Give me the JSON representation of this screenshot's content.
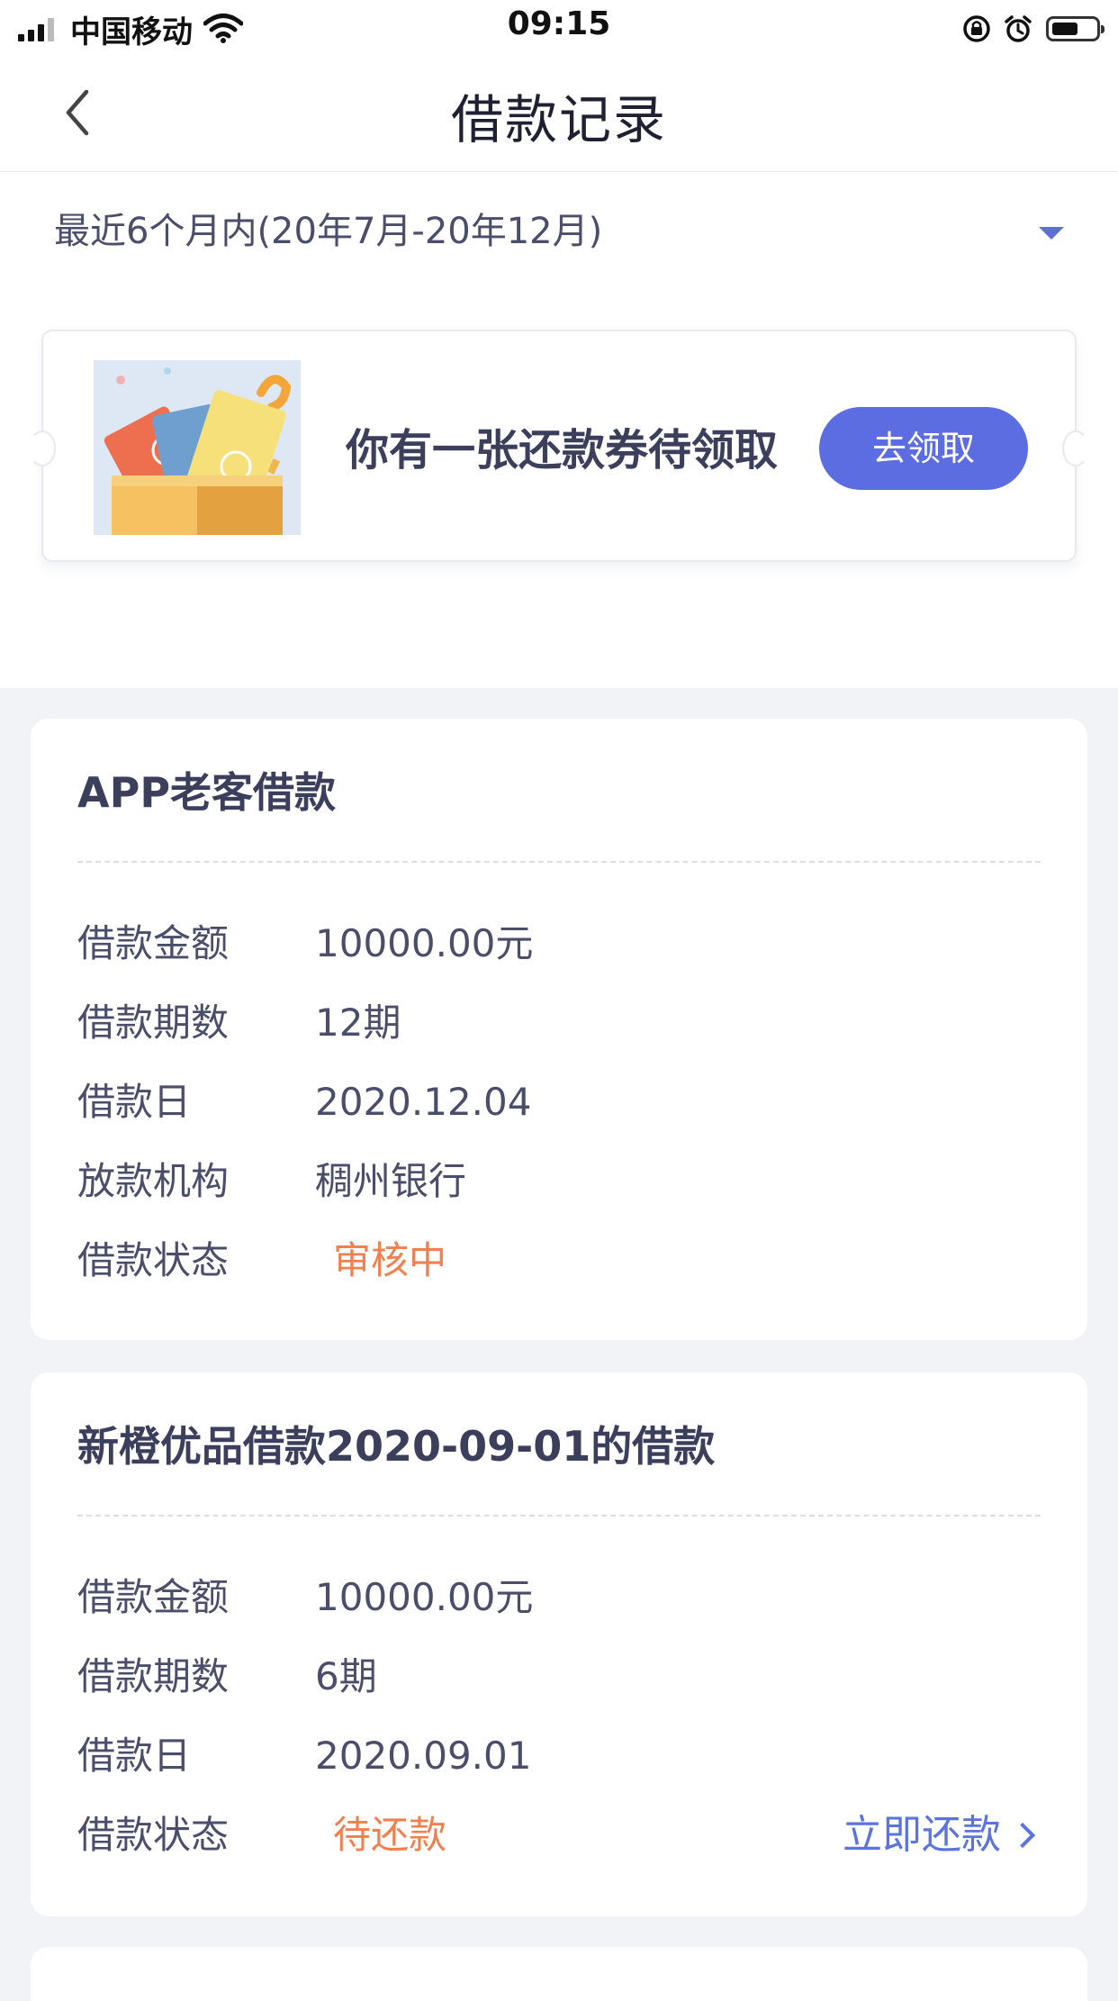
{
  "status_bar": {
    "carrier": "中国移动",
    "time": "09:15",
    "battery_level": 0.6
  },
  "nav": {
    "title": "借款记录"
  },
  "filter": {
    "label": "最近6个月内(20年7月-20年12月)"
  },
  "coupon": {
    "text": "你有一张还款券待领取",
    "button": "去领取"
  },
  "loans": [
    {
      "title": "APP老客借款",
      "rows": [
        {
          "label": "借款金额",
          "value": "10000.00元"
        },
        {
          "label": "借款期数",
          "value": "12期"
        },
        {
          "label": "借款日",
          "value": "2020.12.04"
        },
        {
          "label": "放款机构",
          "value": "稠州银行"
        },
        {
          "label": "借款状态",
          "value": "审核中"
        }
      ]
    },
    {
      "title": "新橙优品借款2020-09-01的借款",
      "rows": [
        {
          "label": "借款金额",
          "value": "10000.00元"
        },
        {
          "label": "借款期数",
          "value": "6期"
        },
        {
          "label": "借款日",
          "value": "2020.09.01"
        },
        {
          "label": "借款状态",
          "value": "待还款"
        }
      ],
      "action": "立即还款"
    }
  ],
  "colors": {
    "accent": "#5b6de0",
    "status": "#f0804f",
    "background": "#f2f3f7"
  }
}
